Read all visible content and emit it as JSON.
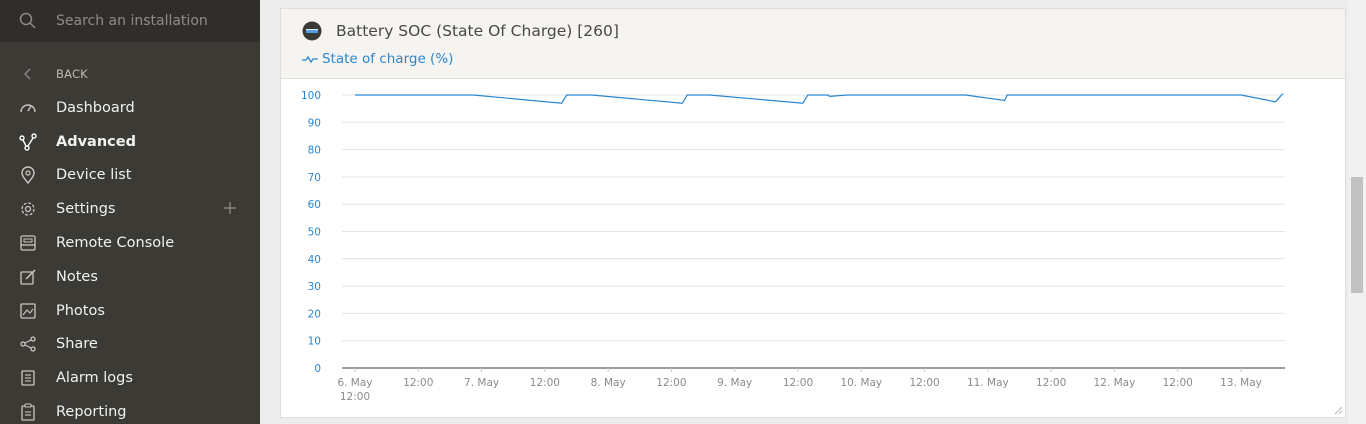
{
  "sidebar": {
    "search_placeholder": "Search an installation",
    "back_label": "BACK",
    "items": [
      {
        "label": "Dashboard",
        "icon": "dashboard-icon",
        "active": false
      },
      {
        "label": "Advanced",
        "icon": "advanced-icon",
        "active": true
      },
      {
        "label": "Device list",
        "icon": "map-pin-icon",
        "active": false
      },
      {
        "label": "Settings",
        "icon": "gear-icon",
        "active": false
      },
      {
        "label": "Remote Console",
        "icon": "console-icon",
        "active": false
      },
      {
        "label": "Notes",
        "icon": "notes-icon",
        "active": false
      },
      {
        "label": "Photos",
        "icon": "photos-icon",
        "active": false
      },
      {
        "label": "Share",
        "icon": "share-icon",
        "active": false
      },
      {
        "label": "Alarm logs",
        "icon": "alarm-logs-icon",
        "active": false
      },
      {
        "label": "Reporting",
        "icon": "reporting-icon",
        "active": false
      }
    ]
  },
  "panel": {
    "title": "Battery SOC (State Of Charge) [260]",
    "legend_label": "State of charge (%)"
  },
  "colors": {
    "accent": "#2b86cf",
    "sidebar_bg": "#3c3a35"
  },
  "chart_data": {
    "type": "line",
    "ylim": [
      0,
      100
    ],
    "y_ticks": [
      "100",
      "90",
      "80",
      "70",
      "60",
      "50",
      "40",
      "30",
      "20",
      "10",
      "0"
    ],
    "x_ticks": [
      "6. May",
      "12:00",
      "7. May",
      "12:00",
      "8. May",
      "12:00",
      "9. May",
      "12:00",
      "10. May",
      "12:00",
      "11. May",
      "12:00",
      "12. May",
      "12:00",
      "13. May"
    ],
    "first_tick_sublabel": "12:00",
    "series": [
      {
        "name": "State of charge (%)",
        "x": [
          "2023-05-06 00:00",
          "2023-05-07 00:00",
          "2023-05-07 18:00",
          "2023-05-07 19:00",
          "2023-05-08 00:00",
          "2023-05-08 18:30",
          "2023-05-08 19:30",
          "2023-05-09 00:00",
          "2023-05-09 19:00",
          "2023-05-09 20:00",
          "2023-05-10 00:00",
          "2023-05-10 00:30",
          "2023-05-10 04:00",
          "2023-05-11 04:00",
          "2023-05-11 12:00",
          "2023-05-11 12:30",
          "2023-05-12 12:00",
          "2023-05-13 12:00",
          "2023-05-13 19:00",
          "2023-05-13 20:30"
        ],
        "values": [
          100,
          100,
          97,
          100,
          100,
          97,
          100,
          100,
          97,
          100,
          100,
          99.5,
          100,
          100,
          98,
          100,
          100,
          100,
          97.5,
          100.5
        ]
      }
    ]
  }
}
